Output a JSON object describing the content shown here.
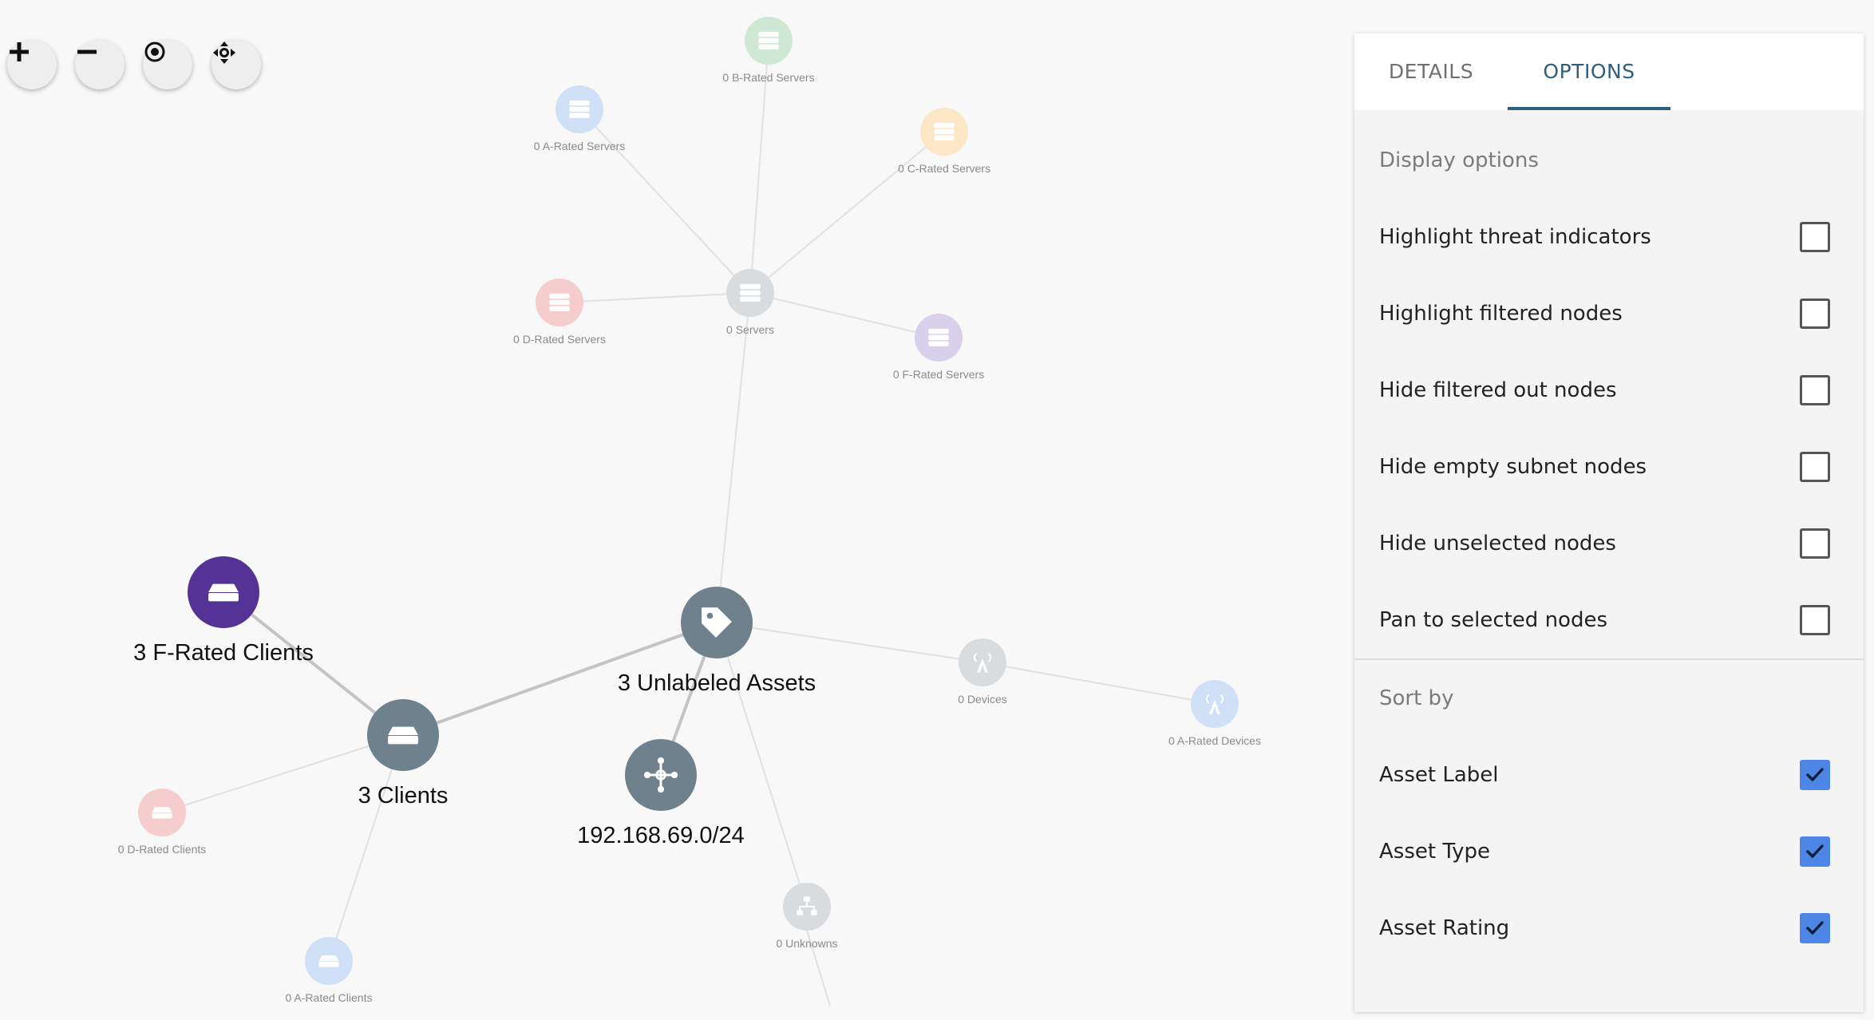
{
  "zoom_controls": {
    "zoom_in_icon": "plus-icon",
    "zoom_out_icon": "minus-icon",
    "center_icon": "target-icon",
    "fit_icon": "move-arrows-icon"
  },
  "graph": {
    "nodes": [
      {
        "id": "b-servers",
        "label": "0 B-Rated Servers",
        "icon": "server-icon",
        "color": "#cfe8d3",
        "faded": true
      },
      {
        "id": "a-servers",
        "label": "0 A-Rated Servers",
        "icon": "server-icon",
        "color": "#cfe0f7",
        "faded": true
      },
      {
        "id": "c-servers",
        "label": "0 C-Rated Servers",
        "icon": "server-icon",
        "color": "#fbe7c6",
        "faded": true
      },
      {
        "id": "d-servers",
        "label": "0 D-Rated Servers",
        "icon": "server-icon",
        "color": "#f5cdcd",
        "faded": true
      },
      {
        "id": "servers",
        "label": "0 Servers",
        "icon": "server-icon",
        "color": "#d9dcdf",
        "faded": true
      },
      {
        "id": "f-servers",
        "label": "0 F-Rated Servers",
        "icon": "server-icon",
        "color": "#d9d0ec",
        "faded": true
      },
      {
        "id": "f-clients",
        "label": "3 F-Rated Clients",
        "icon": "client-icon",
        "color": "#553296",
        "faded": false
      },
      {
        "id": "unlabeled",
        "label": "3 Unlabeled Assets",
        "icon": "tag-icon",
        "color": "#6f818c",
        "faded": false
      },
      {
        "id": "devices",
        "label": "0 Devices",
        "icon": "antenna-icon",
        "color": "#d9dcdf",
        "faded": true
      },
      {
        "id": "a-devices",
        "label": "0 A-Rated Devices",
        "icon": "antenna-icon",
        "color": "#cfe0f7",
        "faded": true
      },
      {
        "id": "clients",
        "label": "3 Clients",
        "icon": "client-icon",
        "color": "#6f818c",
        "faded": false
      },
      {
        "id": "subnet",
        "label": "192.168.69.0/24",
        "icon": "network-icon",
        "color": "#6f818c",
        "faded": false
      },
      {
        "id": "d-clients",
        "label": "0 D-Rated Clients",
        "icon": "client-icon",
        "color": "#f5cdcd",
        "faded": true
      },
      {
        "id": "unknowns",
        "label": "0 Unknowns",
        "icon": "hierarchy-icon",
        "color": "#d9dcdf",
        "faded": true
      },
      {
        "id": "a-clients",
        "label": "0 A-Rated Clients",
        "icon": "client-icon",
        "color": "#cfe0f7",
        "faded": true
      }
    ],
    "edges": [
      [
        "servers",
        "b-servers"
      ],
      [
        "servers",
        "a-servers"
      ],
      [
        "servers",
        "c-servers"
      ],
      [
        "servers",
        "d-servers"
      ],
      [
        "servers",
        "f-servers"
      ],
      [
        "servers",
        "unlabeled"
      ],
      [
        "unlabeled",
        "clients"
      ],
      [
        "unlabeled",
        "subnet"
      ],
      [
        "unlabeled",
        "devices"
      ],
      [
        "unlabeled",
        "unknowns"
      ],
      [
        "devices",
        "a-devices"
      ],
      [
        "clients",
        "f-clients"
      ],
      [
        "clients",
        "d-clients"
      ],
      [
        "clients",
        "a-clients"
      ]
    ]
  },
  "panel": {
    "tabs": [
      {
        "label": "DETAILS",
        "active": false
      },
      {
        "label": "OPTIONS",
        "active": true
      }
    ],
    "display_options": {
      "title": "Display options",
      "items": [
        {
          "label": "Highlight threat indicators",
          "checked": false
        },
        {
          "label": "Highlight filtered nodes",
          "checked": false
        },
        {
          "label": "Hide filtered out nodes",
          "checked": false
        },
        {
          "label": "Hide empty subnet nodes",
          "checked": false
        },
        {
          "label": "Hide unselected nodes",
          "checked": false
        },
        {
          "label": "Pan to selected nodes",
          "checked": false
        }
      ]
    },
    "sort_by": {
      "title": "Sort by",
      "items": [
        {
          "label": "Asset Label",
          "checked": true
        },
        {
          "label": "Asset Type",
          "checked": true
        },
        {
          "label": "Asset Rating",
          "checked": true
        }
      ]
    },
    "accent_color": "#2e5f7f",
    "checkbox_color": "#4e86e8"
  }
}
